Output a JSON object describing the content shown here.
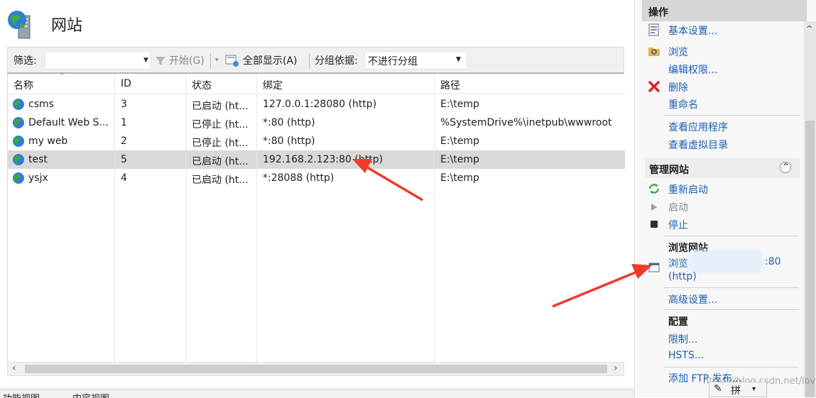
{
  "header": {
    "title": "网站"
  },
  "toolbar": {
    "filter_label": "筛选:",
    "filter_value": "",
    "start_label": "开始(G)",
    "show_all_label": "全部显示(A)",
    "group_by_label": "分组依据:",
    "group_by_value": "不进行分组"
  },
  "table": {
    "columns": [
      "名称",
      "ID",
      "状态",
      "绑定",
      "路径"
    ],
    "rows": [
      {
        "name": "csms",
        "id": "3",
        "status": "已启动 (ht...",
        "binding": "127.0.0.1:28080 (http)",
        "path": "E:\\temp",
        "selected": false
      },
      {
        "name": "Default Web S...",
        "id": "1",
        "status": "已停止 (ht...",
        "binding": "*:80 (http)",
        "path": "%SystemDrive%\\inetpub\\wwwroot",
        "selected": false
      },
      {
        "name": "my web",
        "id": "2",
        "status": "已停止 (ht...",
        "binding": "*:80 (http)",
        "path": "E:\\temp",
        "selected": false
      },
      {
        "name": "test",
        "id": "5",
        "status": "已启动 (ht...",
        "binding": "192.168.2.123:80 (http)",
        "path": "E:\\temp",
        "selected": true
      },
      {
        "name": "ysjx",
        "id": "4",
        "status": "已启动 (ht...",
        "binding": "*:28088 (http)",
        "path": "E:\\temp",
        "selected": false
      }
    ]
  },
  "bottom_tabs": {
    "features_view": "功能视图",
    "content_view": "内容视图"
  },
  "actions": {
    "title": "操作",
    "basic_settings": "基本设置...",
    "browse": "浏览",
    "edit_permissions": "编辑权限...",
    "delete": "删除",
    "rename": "重命名",
    "view_applications": "查看应用程序",
    "view_virtual_dirs": "查看虚拟目录",
    "manage_site": "管理网站",
    "restart": "重新启动",
    "start": "启动",
    "stop": "停止",
    "browse_site": "浏览网站",
    "browse_link_prefix": "浏览",
    "browse_link_suffix": ":80",
    "browse_link_http": "(http)",
    "advanced_settings": "高级设置...",
    "config": "配置",
    "limits": "限制...",
    "hsts": "HSTS...",
    "add_ftp": "添加 FTP 发布..."
  },
  "overlay": {
    "watermark": "https://blog.csdn.net/love_story",
    "ime_pin": "拼"
  },
  "colors": {
    "link": "#1a5fb4",
    "selected_row": "#d9d9d9",
    "annotation_arrow": "#f03a2a"
  }
}
